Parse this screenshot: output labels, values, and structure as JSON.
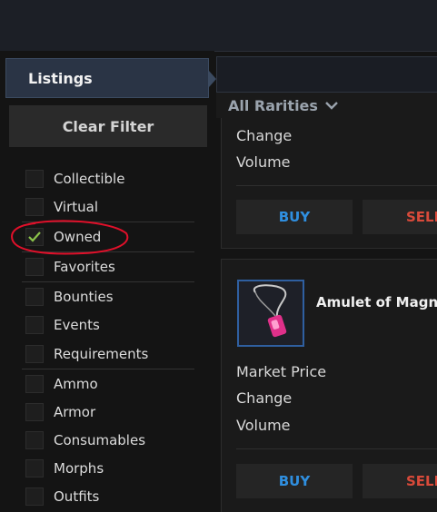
{
  "tabs": {
    "listings": "Listings"
  },
  "filter_panel": {
    "clear_filter": "Clear Filter",
    "filters": [
      {
        "label": "Collectible",
        "checked": false
      },
      {
        "label": "Virtual",
        "checked": false
      },
      {
        "label": "Owned",
        "checked": true
      },
      {
        "label": "Favorites",
        "checked": false
      },
      {
        "label": "Bounties",
        "checked": false
      },
      {
        "label": "Events",
        "checked": false
      },
      {
        "label": "Requirements",
        "checked": false
      },
      {
        "label": "Ammo",
        "checked": false
      },
      {
        "label": "Armor",
        "checked": false
      },
      {
        "label": "Consumables",
        "checked": false
      },
      {
        "label": "Morphs",
        "checked": false
      },
      {
        "label": "Outfits",
        "checked": false
      }
    ]
  },
  "rarity": {
    "label": "All Rarities",
    "icon": "chevron-down-icon"
  },
  "cards": [
    {
      "name": "",
      "stats": [
        "Change",
        "Volume"
      ],
      "buy": "BUY",
      "sell": "SELL"
    },
    {
      "name": "Amulet of Magne",
      "icon": "amulet-icon",
      "stats": [
        "Market Price",
        "Change",
        "Volume"
      ],
      "buy": "BUY",
      "sell": "SELL"
    }
  ],
  "colors": {
    "accent_blue": "#2f8fe0",
    "sell_red": "#d94a3a",
    "check_green": "#8bc34a",
    "annotation_red": "#e0102a"
  }
}
